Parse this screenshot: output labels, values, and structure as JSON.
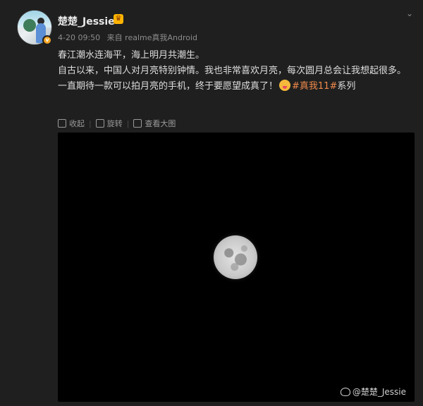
{
  "post": {
    "author": "楚楚_Jessie",
    "time": "4-20 09:50",
    "source": "来自 realme真我Android",
    "lines": [
      "春江潮水连海平，海上明月共潮生。",
      "自古以来，中国人对月亮特别钟情。我也非常喜欢月亮，每次圆月总会让我想起很多。",
      "一直期待一款可以拍月亮的手机，终于要愿望成真了！"
    ],
    "hashtag": "#真我11#",
    "hashtag_suffix": "系列",
    "verified_badge": "v"
  },
  "actions": {
    "collapse": "收起",
    "rotate": "旋转",
    "view_large": "查看大图"
  },
  "watermark": "@楚楚_Jessie",
  "colors": {
    "background": "#1f1f1f",
    "hashtag": "#f08a4b",
    "badge": "#f5a623"
  },
  "icons": [
    "chevron-down-icon",
    "collapse-icon",
    "rotate-icon",
    "view-large-icon",
    "weibo-icon",
    "vip-crown-icon"
  ]
}
